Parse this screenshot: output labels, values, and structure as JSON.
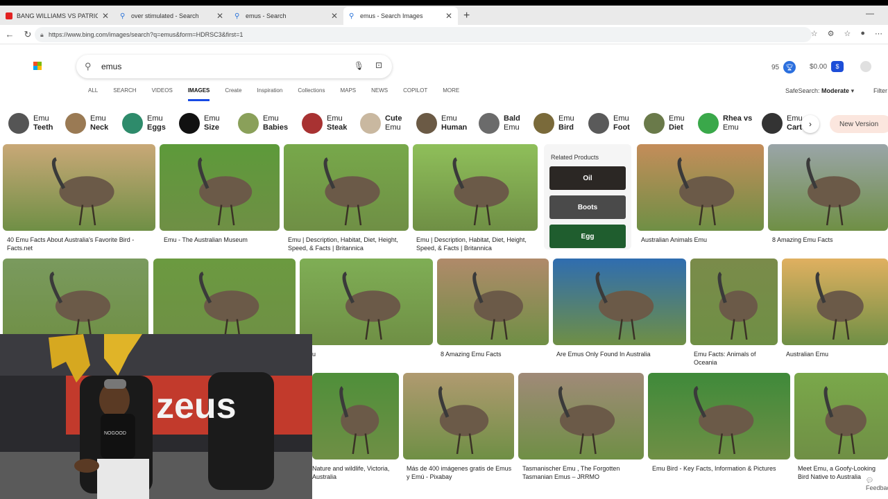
{
  "browser": {
    "tabs": [
      {
        "label": "BANG WILLIAMS VS PATRICK OKI",
        "color": "#e22222"
      },
      {
        "label": "over stimulated - Search",
        "color": "#2a73d9"
      },
      {
        "label": "emus - Search",
        "color": "#2a73d9"
      },
      {
        "label": "emus - Search Images",
        "color": "#2a73d9"
      }
    ],
    "new_tab": "+",
    "url": "https://www.bing.com/images/search?q=emus&form=HDRSC3&first=1"
  },
  "bing": {
    "search_value": "emus",
    "scopes": [
      "ALL",
      "SEARCH",
      "VIDEOS",
      "IMAGES",
      "Create",
      "Inspiration",
      "Collections",
      "MAPS",
      "NEWS",
      "COPILOT",
      "MORE"
    ],
    "active_scope": "IMAGES",
    "rewards_points": "95",
    "money": "$0.00",
    "safesearch_label": "SafeSearch:",
    "safesearch_value": "Moderate",
    "filter_label": "Filter"
  },
  "pills": [
    {
      "a": "Emu",
      "b": "Teeth",
      "bold": "b",
      "color": "#555"
    },
    {
      "a": "Emu",
      "b": "Neck",
      "bold": "b",
      "color": "#9a7a54"
    },
    {
      "a": "Emu",
      "b": "Eggs",
      "bold": "b",
      "color": "#2e8b6b"
    },
    {
      "a": "Emu",
      "b": "Size",
      "bold": "b",
      "color": "#111"
    },
    {
      "a": "Emu",
      "b": "Babies",
      "bold": "b",
      "color": "#8aa05a"
    },
    {
      "a": "Emu",
      "b": "Steak",
      "bold": "b",
      "color": "#a83232"
    },
    {
      "a": "Cute",
      "b": "Emu",
      "bold": "a",
      "color": "#c9b8a0"
    },
    {
      "a": "Emu",
      "b": "Human",
      "bold": "b",
      "color": "#6b5a45"
    },
    {
      "a": "Bald",
      "b": "Emu",
      "bold": "a",
      "color": "#6b6b6b"
    },
    {
      "a": "Emu",
      "b": "Bird",
      "bold": "b",
      "color": "#7a6a3a"
    },
    {
      "a": "Emu",
      "b": "Foot",
      "bold": "b",
      "color": "#5a5a5a"
    },
    {
      "a": "Emu",
      "b": "Diet",
      "bold": "b",
      "color": "#6a7a4a"
    },
    {
      "a": "Rhea vs",
      "b": "Emu",
      "bold": "a",
      "color": "#3aa84a"
    },
    {
      "a": "Emu",
      "b": "Carto",
      "bold": "b",
      "color": "#333"
    }
  ],
  "new_version": "New Version",
  "related": {
    "title": "Related Products",
    "items": [
      "Oil",
      "Boots",
      "Egg"
    ]
  },
  "results": [
    {
      "caption": "40 Emu Facts About Australia's Favorite Bird - Facts.net"
    },
    {
      "caption": "Emu - The Australian Museum"
    },
    {
      "caption": "Emu | Description, Habitat, Diet, Height, Speed, & Facts | Britannica"
    },
    {
      "caption": "Emu | Description, Habitat, Diet, Height, Speed, & Facts | Britannica"
    },
    {
      "caption": "Australian Animals Emu"
    },
    {
      "caption": "8 Amazing Emu Facts"
    },
    {
      "caption": "u"
    },
    {
      "caption": "8 Amazing Emu Facts"
    },
    {
      "caption": "Are Emus Only Found In Australia"
    },
    {
      "caption": "Emu Facts: Animals of Oceania"
    },
    {
      "caption": "Australian Emu"
    },
    {
      "caption": "Nature and wildlife, Victoria, Australia"
    },
    {
      "caption": "Más de 400 imágenes gratis de Emus y Emú - Pixabay"
    },
    {
      "caption": "Tasmanischer Emu , The Forgotten Tasmanian Emus – JRRMO"
    },
    {
      "caption": "Emu Bird - Key Facts, Information & Pictures"
    },
    {
      "caption": "Meet Emu, a Goofy-Looking Bird Native to Australia"
    }
  ],
  "webcam": {
    "sign_text": "zeus",
    "shirt_text": "NOGOOD"
  },
  "feedback": "Feedback"
}
